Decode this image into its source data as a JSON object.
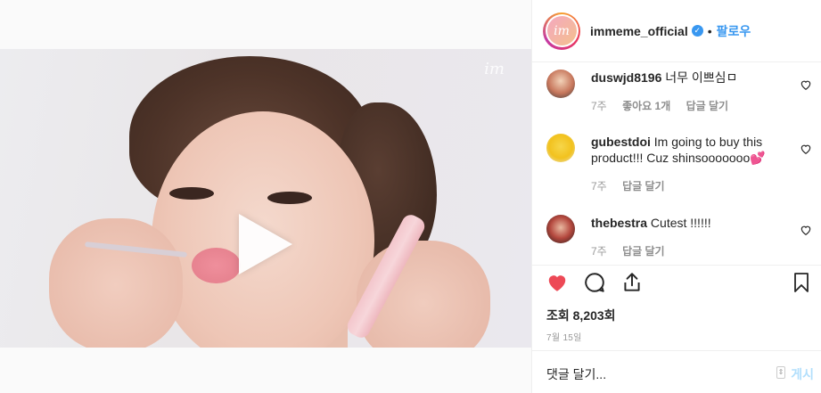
{
  "post": {
    "username": "immeme_official",
    "avatar_text": "im",
    "follow_label": "팔로우",
    "separator": "•",
    "verified_icon": "check-icon"
  },
  "media": {
    "watermark": "im",
    "play_icon": "play-icon"
  },
  "comments": [
    {
      "user": "duswjd8196",
      "text": "너무 이쁘심ㅁ",
      "age": "7주",
      "likes": "좋아요 1개",
      "reply": "답글 달기"
    },
    {
      "user": "gubestdoi",
      "text": "Im going to buy this product!!! Cuz shinsooooooo💕",
      "age": "7주",
      "reply": "답글 달기"
    },
    {
      "user": "thebestra",
      "text": "Cutest !!!!!!",
      "age": "7주",
      "reply": "답글 달기"
    }
  ],
  "actions": {
    "views": "조회 8,203회",
    "date": "7월 15일",
    "comment_placeholder": "댓글 달기...",
    "post_label": "게시"
  },
  "colors": {
    "accent": "#3897f0",
    "like_red": "#ed4956",
    "post_disabled": "#b2dffc"
  }
}
